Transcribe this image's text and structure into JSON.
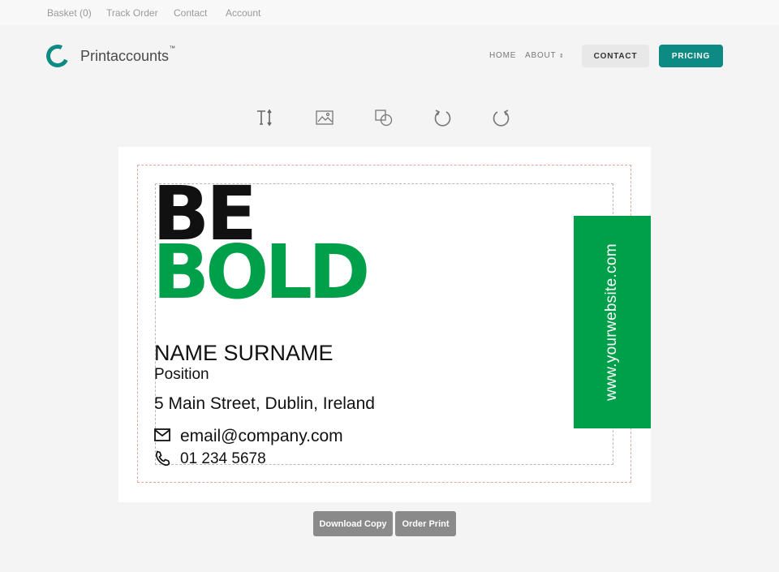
{
  "topbar": {
    "links": [
      "Basket (0)",
      "Track Order",
      "Contact",
      "Account"
    ]
  },
  "header": {
    "brand": "Printaccounts",
    "trademark": "™",
    "nav": {
      "home": "HOME",
      "about": "ABOUT"
    },
    "contact_label": "CONTACT",
    "pricing_label": "PRICING",
    "accent_color": "#0e8a85"
  },
  "toolbar": {
    "tools": [
      "text-tool-icon",
      "image-tool-icon",
      "shapes-tool-icon",
      "undo-icon",
      "redo-icon"
    ]
  },
  "card": {
    "headline_1": "BE",
    "headline_2": "BOLD",
    "name": "NAME SURNAME",
    "position": "Position",
    "address": "5 Main Street, Dublin, Ireland",
    "email": "email@company.com",
    "phone": "01 234 5678",
    "website": "www.yourwebsite.com",
    "accent_color": "#00a04a"
  },
  "actions": {
    "download_label": "Download Copy",
    "order_label": "Order Print"
  }
}
